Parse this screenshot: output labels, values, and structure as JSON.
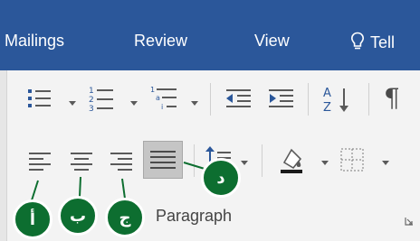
{
  "tabs": {
    "mailings": "Mailings",
    "review": "Review",
    "view": "View",
    "tell": "Tell"
  },
  "icons": {
    "bullets": "bullets-icon",
    "numbering": "numbering-icon",
    "multilevel": "multilevel-list-icon",
    "decrease_indent": "decrease-indent-icon",
    "increase_indent": "increase-indent-icon",
    "sort": "sort-icon",
    "show_marks": "pilcrow-icon",
    "align_left": "align-left-icon",
    "center": "align-center-icon",
    "align_right": "align-right-icon",
    "justify": "justify-icon",
    "line_spacing": "line-spacing-icon",
    "shading": "shading-icon",
    "borders": "borders-icon",
    "lightbulb": "lightbulb-icon"
  },
  "sort_glyph": {
    "top": "A",
    "bottom": "Z"
  },
  "pilcrow": "¶",
  "group": {
    "label": "Paragraph"
  },
  "badges": {
    "a": "أ",
    "b": "ب",
    "c": "ج",
    "d": "د"
  },
  "colors": {
    "tab_bar": "#2b579a",
    "ribbon_bg": "#f3f3f3",
    "badge": "#0d6e30",
    "active_button": "#c5c5c5",
    "indent_arrow": "#2b579a"
  },
  "state": {
    "active_alignment": "justify"
  }
}
